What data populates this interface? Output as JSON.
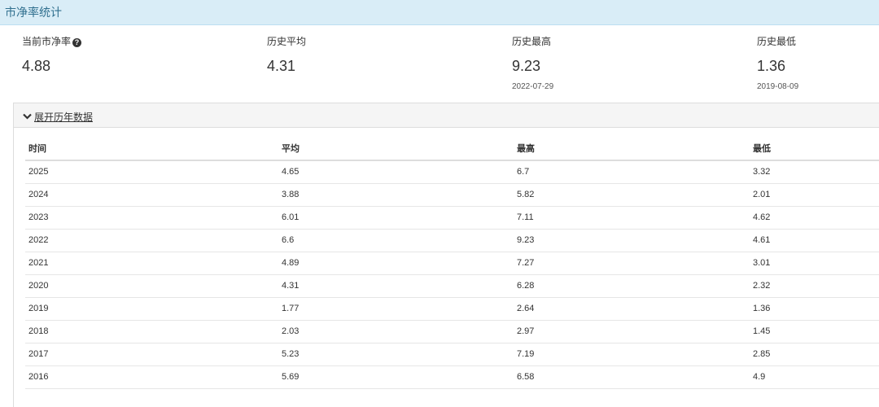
{
  "header": {
    "title": "市净率统计"
  },
  "stats": [
    {
      "label": "当前市净率",
      "value": "4.88",
      "date": ""
    },
    {
      "label": "历史平均",
      "value": "4.31",
      "date": ""
    },
    {
      "label": "历史最高",
      "value": "9.23",
      "date": "2022-07-29"
    },
    {
      "label": "历史最低",
      "value": "1.36",
      "date": "2019-08-09"
    }
  ],
  "panel": {
    "toggle_label": "展开历年数据"
  },
  "table": {
    "headers": [
      "时间",
      "平均",
      "最高",
      "最低"
    ],
    "rows": [
      [
        "2025",
        "4.65",
        "6.7",
        "3.32"
      ],
      [
        "2024",
        "3.88",
        "5.82",
        "2.01"
      ],
      [
        "2023",
        "6.01",
        "7.11",
        "4.62"
      ],
      [
        "2022",
        "6.6",
        "9.23",
        "4.61"
      ],
      [
        "2021",
        "4.89",
        "7.27",
        "3.01"
      ],
      [
        "2020",
        "4.31",
        "6.28",
        "2.32"
      ],
      [
        "2019",
        "1.77",
        "2.64",
        "1.36"
      ],
      [
        "2018",
        "2.03",
        "2.97",
        "1.45"
      ],
      [
        "2017",
        "5.23",
        "7.19",
        "2.85"
      ],
      [
        "2016",
        "5.69",
        "6.58",
        "4.9"
      ]
    ]
  }
}
